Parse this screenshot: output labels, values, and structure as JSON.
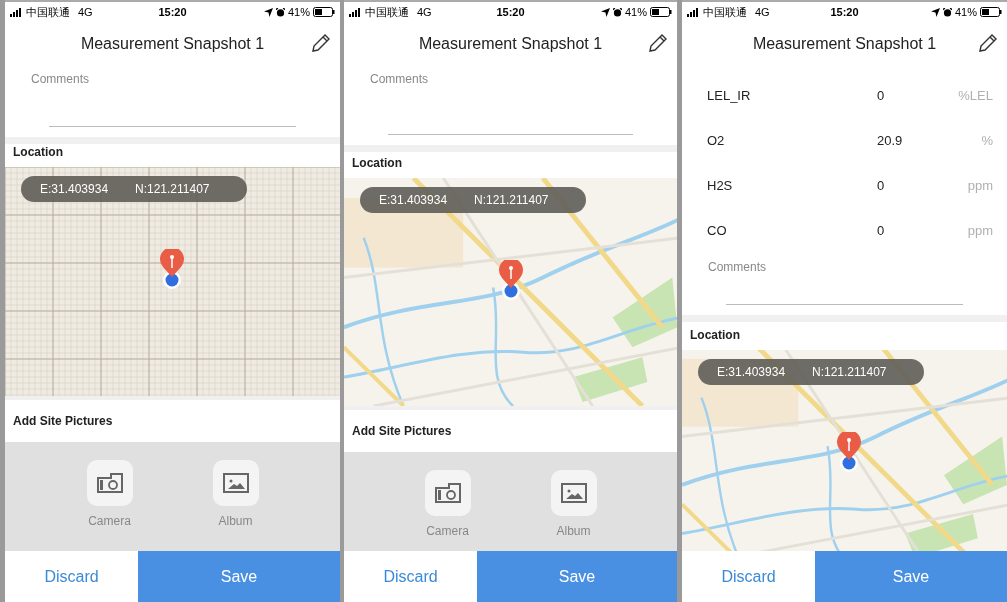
{
  "screens": [
    {
      "status_bar": {
        "carrier": "中国联通",
        "network": "4G",
        "time": "15:20",
        "battery": "41%"
      },
      "title": "Measurement Snapshot 1",
      "comments": {
        "label": "Comments"
      },
      "location": {
        "label": "Location",
        "east": "E:31.403934",
        "north": "N:121.211407",
        "tiles_loaded": false
      },
      "pictures": {
        "label": "Add Site Pictures",
        "options": [
          {
            "label": "Camera",
            "kind": "camera"
          },
          {
            "label": "Album",
            "kind": "album"
          }
        ]
      },
      "buttons": [
        {
          "label": "Discard",
          "kind": "secondary"
        },
        {
          "label": "Save",
          "kind": "primary"
        }
      ]
    },
    {
      "status_bar": {
        "carrier": "中国联通",
        "network": "4G",
        "time": "15:20",
        "battery": "41%"
      },
      "title": "Measurement Snapshot 1",
      "comments": {
        "label": "Comments"
      },
      "location": {
        "label": "Location",
        "east": "E:31.403934",
        "north": "N:121.211407",
        "tiles_loaded": true
      },
      "pictures": {
        "label": "Add Site Pictures",
        "options": [
          {
            "label": "Camera",
            "kind": "camera"
          },
          {
            "label": "Album",
            "kind": "album"
          }
        ]
      },
      "buttons": [
        {
          "label": "Discard",
          "kind": "secondary"
        },
        {
          "label": "Save",
          "kind": "primary"
        }
      ]
    },
    {
      "status_bar": {
        "carrier": "中国联通",
        "network": "4G",
        "time": "15:20",
        "battery": "41%"
      },
      "title": "Measurement Snapshot 1",
      "readings": [
        {
          "name": "LEL_IR",
          "value": "0",
          "unit": "%LEL"
        },
        {
          "name": "O2",
          "value": "20.9",
          "unit": "%"
        },
        {
          "name": "H2S",
          "value": "0",
          "unit": "ppm"
        },
        {
          "name": "CO",
          "value": "0",
          "unit": "ppm"
        }
      ],
      "comments": {
        "label": "Comments"
      },
      "location": {
        "label": "Location",
        "east": "E:31.403934",
        "north": "N:121.211407",
        "tiles_loaded": true
      },
      "buttons": [
        {
          "label": "Discard",
          "kind": "secondary"
        },
        {
          "label": "Save",
          "kind": "primary"
        }
      ]
    }
  ]
}
